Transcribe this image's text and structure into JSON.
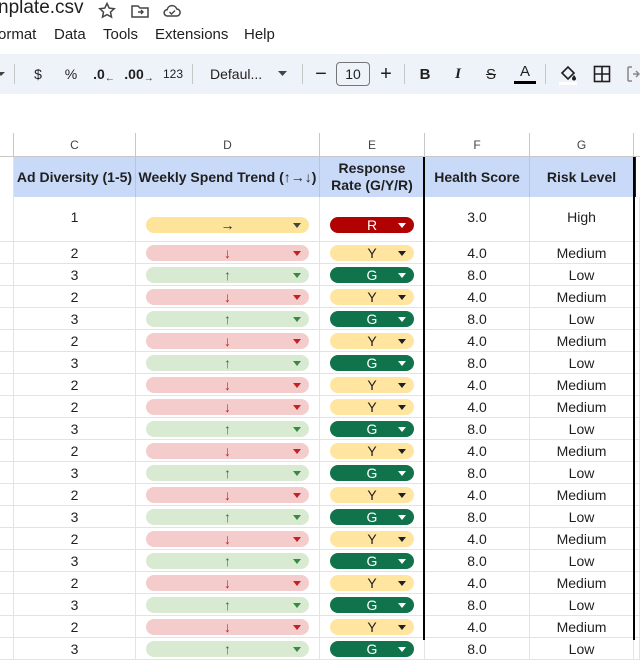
{
  "title": "nplate.csv",
  "menu": [
    "ormat",
    "Data",
    "Tools",
    "Extensions",
    "Help"
  ],
  "toolbar": {
    "currency": "$",
    "percent": "%",
    "dec_decrease": ".0",
    "dec_increase": ".00",
    "number_format": "123",
    "font": "Defaul...",
    "font_size": "10",
    "minus": "−",
    "plus": "+",
    "bold": "B",
    "italic": "I",
    "strike": "S",
    "text_color": "A"
  },
  "columns": [
    "C",
    "D",
    "E",
    "F",
    "G"
  ],
  "headers": {
    "c": "Ad Diversity (1-5)",
    "d": "Weekly Spend Trend (↑→↓)",
    "e_line1": "Response",
    "e_line2": "Rate (G/Y/R)",
    "f": "Health Score",
    "g": "Risk Level"
  },
  "colors": {
    "header_bg": "#c9daf8",
    "chip_red_bg": "#f4cccc",
    "chip_green_bg": "#d9ead3",
    "chip_yellow_bg": "#fde49a",
    "arrow_up": "#2e7d32",
    "arrow_down": "#c5221f",
    "rate_G": "#11734b",
    "rate_Y": "#ffe5a0",
    "rate_R": "#b10202"
  },
  "rows": [
    {
      "c": "1",
      "d": "→",
      "e": "R",
      "f": "3.0",
      "g": "High"
    },
    {
      "c": "2",
      "d": "↓",
      "e": "Y",
      "f": "4.0",
      "g": "Medium"
    },
    {
      "c": "3",
      "d": "↑",
      "e": "G",
      "f": "8.0",
      "g": "Low"
    },
    {
      "c": "2",
      "d": "↓",
      "e": "Y",
      "f": "4.0",
      "g": "Medium"
    },
    {
      "c": "3",
      "d": "↑",
      "e": "G",
      "f": "8.0",
      "g": "Low"
    },
    {
      "c": "2",
      "d": "↓",
      "e": "Y",
      "f": "4.0",
      "g": "Medium"
    },
    {
      "c": "3",
      "d": "↑",
      "e": "G",
      "f": "8.0",
      "g": "Low"
    },
    {
      "c": "2",
      "d": "↓",
      "e": "Y",
      "f": "4.0",
      "g": "Medium"
    },
    {
      "c": "2",
      "d": "↓",
      "e": "Y",
      "f": "4.0",
      "g": "Medium"
    },
    {
      "c": "3",
      "d": "↑",
      "e": "G",
      "f": "8.0",
      "g": "Low"
    },
    {
      "c": "2",
      "d": "↓",
      "e": "Y",
      "f": "4.0",
      "g": "Medium"
    },
    {
      "c": "3",
      "d": "↑",
      "e": "G",
      "f": "8.0",
      "g": "Low"
    },
    {
      "c": "2",
      "d": "↓",
      "e": "Y",
      "f": "4.0",
      "g": "Medium"
    },
    {
      "c": "3",
      "d": "↑",
      "e": "G",
      "f": "8.0",
      "g": "Low"
    },
    {
      "c": "2",
      "d": "↓",
      "e": "Y",
      "f": "4.0",
      "g": "Medium"
    },
    {
      "c": "3",
      "d": "↑",
      "e": "G",
      "f": "8.0",
      "g": "Low"
    },
    {
      "c": "2",
      "d": "↓",
      "e": "Y",
      "f": "4.0",
      "g": "Medium"
    },
    {
      "c": "3",
      "d": "↑",
      "e": "G",
      "f": "8.0",
      "g": "Low"
    },
    {
      "c": "2",
      "d": "↓",
      "e": "Y",
      "f": "4.0",
      "g": "Medium"
    },
    {
      "c": "3",
      "d": "↑",
      "e": "G",
      "f": "8.0",
      "g": "Low"
    }
  ]
}
